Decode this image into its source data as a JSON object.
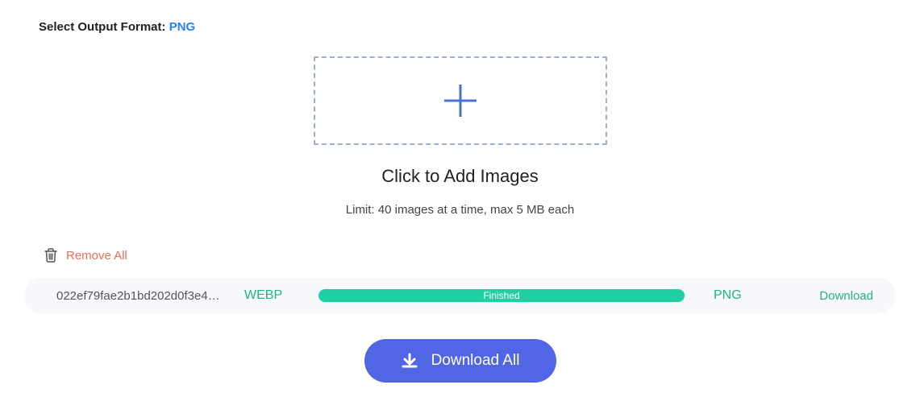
{
  "format": {
    "label": "Select Output Format: ",
    "value": "PNG"
  },
  "dropzone": {
    "title": "Click to Add Images",
    "limit": "Limit: 40 images at a time, max 5 MB each"
  },
  "remove_all": "Remove All",
  "file": {
    "name": "022ef79fae2b1bd202d0f3e4…",
    "src_format": "WEBP",
    "status": "Finished",
    "out_format": "PNG",
    "download": "Download"
  },
  "download_all": "Download All"
}
